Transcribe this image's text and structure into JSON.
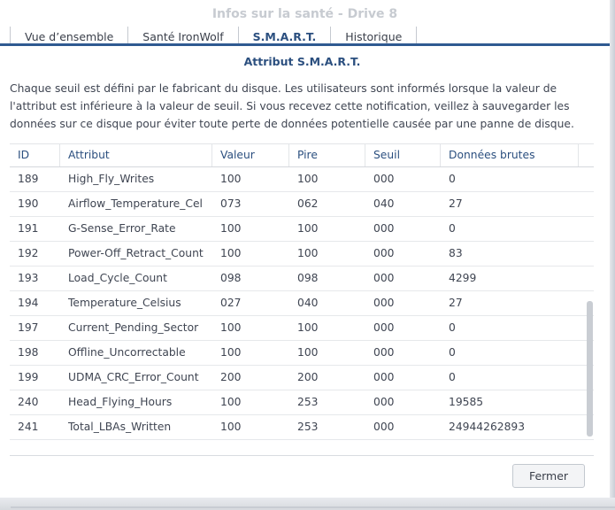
{
  "window": {
    "title": "Infos sur la santé - Drive 8"
  },
  "tabs": [
    {
      "label": "Vue d’ensemble",
      "active": false
    },
    {
      "label": "Santé IronWolf",
      "active": false
    },
    {
      "label": "S.M.A.R.T.",
      "active": true
    },
    {
      "label": "Historique",
      "active": false
    }
  ],
  "section": {
    "title": "Attribut S.M.A.R.T.",
    "description": "Chaque seuil est défini par le fabricant du disque. Les utilisateurs sont informés lorsque la valeur de l'attribut est inférieure à la valeur de seuil. Si vous recevez cette notification, veillez à sauvegarder les données sur ce disque pour éviter toute perte de données potentielle causée par une panne de disque."
  },
  "table": {
    "columns": [
      "ID",
      "Attribut",
      "Valeur",
      "Pire",
      "Seuil",
      "Données brutes"
    ],
    "rows": [
      [
        "189",
        "High_Fly_Writes",
        "100",
        "100",
        "000",
        "0"
      ],
      [
        "190",
        "Airflow_Temperature_Cel",
        "073",
        "062",
        "040",
        "27"
      ],
      [
        "191",
        "G-Sense_Error_Rate",
        "100",
        "100",
        "000",
        "0"
      ],
      [
        "192",
        "Power-Off_Retract_Count",
        "100",
        "100",
        "000",
        "83"
      ],
      [
        "193",
        "Load_Cycle_Count",
        "098",
        "098",
        "000",
        "4299"
      ],
      [
        "194",
        "Temperature_Celsius",
        "027",
        "040",
        "000",
        "27"
      ],
      [
        "197",
        "Current_Pending_Sector",
        "100",
        "100",
        "000",
        "0"
      ],
      [
        "198",
        "Offline_Uncorrectable",
        "100",
        "100",
        "000",
        "0"
      ],
      [
        "199",
        "UDMA_CRC_Error_Count",
        "200",
        "200",
        "000",
        "0"
      ],
      [
        "240",
        "Head_Flying_Hours",
        "100",
        "253",
        "000",
        "19585"
      ],
      [
        "241",
        "Total_LBAs_Written",
        "100",
        "253",
        "000",
        "24944262893"
      ]
    ]
  },
  "footer": {
    "close_label": "Fermer"
  }
}
